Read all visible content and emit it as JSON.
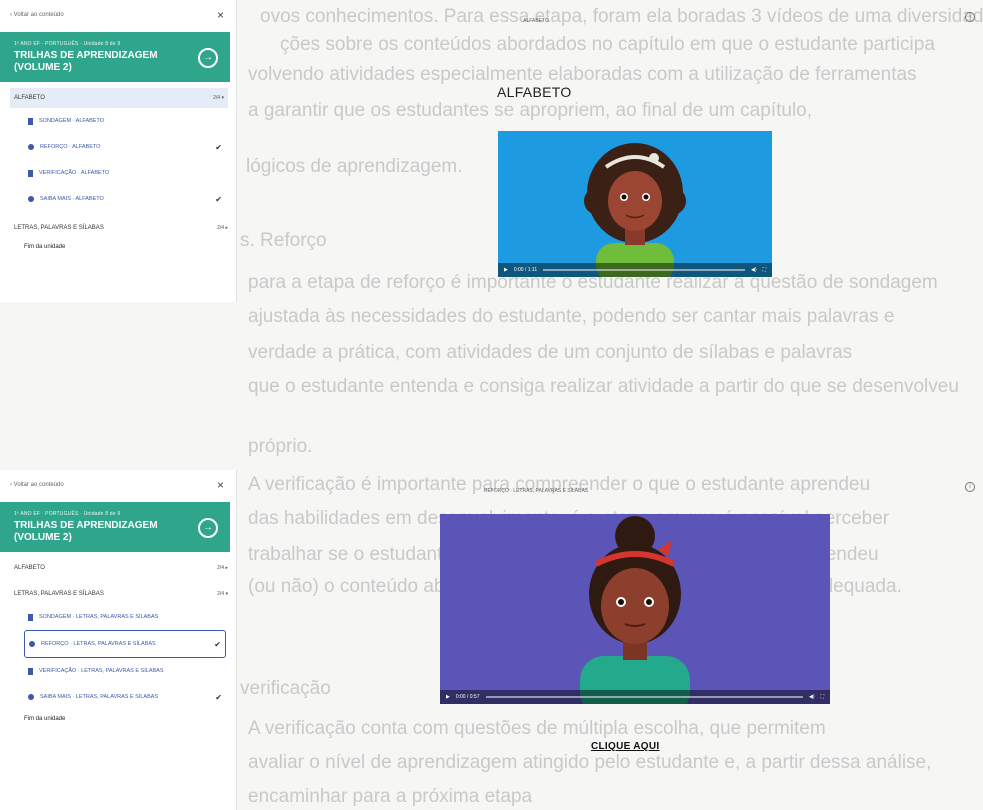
{
  "background_text": [
    "ovos conhecimentos. Para essa etapa, foram ela boradas 3 vídeos de uma diversidade",
    "ções sobre os conteúdos abordados no capítulo em que o estudante participa",
    "volvendo atividades especialmente elaboradas com a utilização de ferramentas",
    "a garantir que os estudantes se apropriem, ao final de um capítulo,",
    "lógicos de aprendizagem.",
    "s. Reforço",
    "para a etapa de reforço é importante o estudante realizar a questão de sondagem",
    "ajustada às necessidades do estudante, podendo ser cantar mais palavras e",
    "verdade a prática, com atividades de um conjunto de sílabas e palavras",
    "que o estudante entenda e consiga realizar atividade a partir do que se desenvolveu",
    "próprio.",
    "A verificação é importante para compreender o que o estudante aprendeu",
    "das habilidades em desenvolvimento, é a etapa em que é possível perceber",
    "trabalhar se o estudante conseguiu lidar com isso e também que aprendeu",
    "(ou não) o conteúdo abordado, para que o sistema ofereça a trilha adequada.",
    "verificação",
    "A verificação conta com questões de múltipla escolha, que permitem",
    "avaliar o nível de aprendizagem atingido pelo estudante e, a partir dessa análise,",
    "encaminhar para a próxima etapa"
  ],
  "panel1": {
    "back_label": "Voltar ao conteúdo",
    "close_icon": "×",
    "header_sub": "1º ANO EF · PORTUGUÊS · Unidade 8 de 9",
    "header_title": "TRILHAS DE APRENDIZAGEM (VOLUME 2)",
    "next_icon": "→",
    "module_active": {
      "label": "ALFABETO",
      "count": "2/4 ▾"
    },
    "items": [
      {
        "label": "SONDAGEM · ALFABETO",
        "icon": "video-icon",
        "checked": false
      },
      {
        "label": "REFORÇO · ALFABETO",
        "icon": "dot-icon",
        "checked": true
      },
      {
        "label": "VERIFICAÇÃO · ALFABETO",
        "icon": "video-icon",
        "checked": false
      },
      {
        "label": "SAIBA MAIS · ALFABETO",
        "icon": "dot-icon",
        "checked": true
      }
    ],
    "check": "✔",
    "module_next": {
      "label": "LETRAS, PALAVRAS E SÍLABAS",
      "count": "2/4 ▸"
    },
    "end_label": "Fim da unidade",
    "content_title": "ALFABETO",
    "lesson_heading": "ALFABETO",
    "info_icon": "i",
    "video_time": "0:00 / 1:11"
  },
  "panel2": {
    "back_label": "Voltar ao conteúdo",
    "close_icon": "×",
    "header_sub": "1º ANO EF · PORTUGUÊS · Unidade 8 de 9",
    "header_title": "TRILHAS DE APRENDIZAGEM (VOLUME 2)",
    "next_icon": "→",
    "module_prev": {
      "label": "ALFABETO",
      "count": "2/4 ▸"
    },
    "module_active": {
      "label": "LETRAS, PALAVRAS E SÍLABAS",
      "count": "2/4 ▾"
    },
    "items": [
      {
        "label": "SONDAGEM · LETRAS, PALAVRAS E SÍLABAS",
        "icon": "video-icon",
        "checked": false
      },
      {
        "label": "REFORÇO · LETRAS, PALAVRAS E SÍLABAS",
        "icon": "dot-icon",
        "checked": true
      },
      {
        "label": "VERIFICAÇÃO · LETRAS, PALAVRAS E SÍLABAS",
        "icon": "video-icon",
        "checked": false
      },
      {
        "label": "SAIBA MAIS · LETRAS, PALAVRAS E SÍLABAS",
        "icon": "dot-icon",
        "checked": true
      }
    ],
    "check": "✔",
    "end_label": "Fim da unidade",
    "content_title": "REFORÇO · LETRAS, PALAVRAS E SÍLABAS",
    "info_icon": "i",
    "video_time": "0:00 / 0:57"
  },
  "link": "CLIQUE AQUI",
  "colors": {
    "accent": "#2fa58b",
    "link_blue": "#3d5aa8",
    "video1_bg": "#1e9be0",
    "video2_bg": "#5b55b8"
  }
}
